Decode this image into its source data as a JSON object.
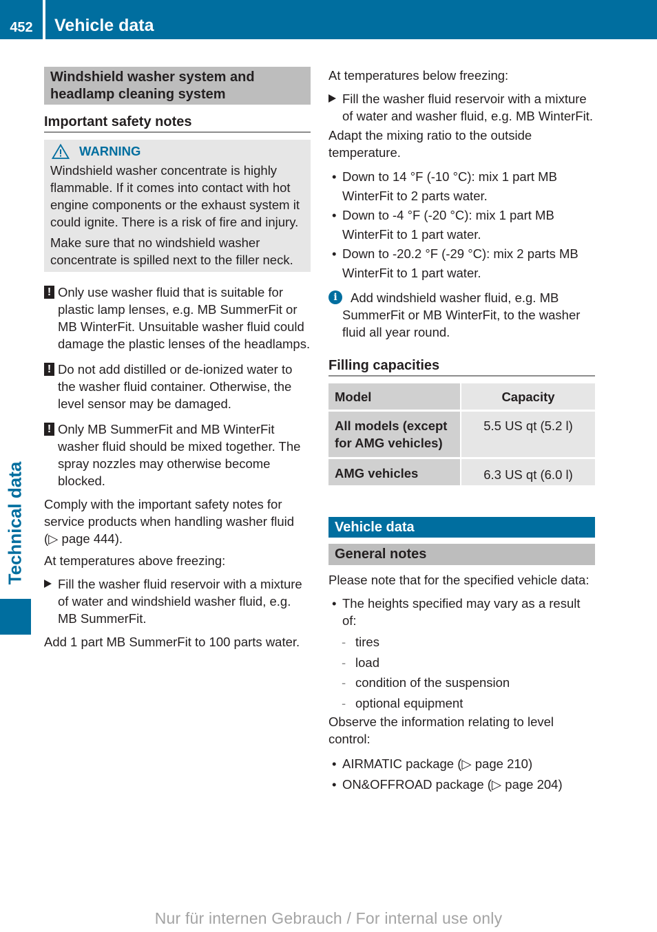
{
  "header": {
    "page_number": "452",
    "title": "Vehicle data"
  },
  "side_tab": {
    "label": "Technical data",
    "color": "#006e9f"
  },
  "left": {
    "section_title": "Windshield washer system and headlamp cleaning system",
    "subsection_title": "Important safety notes",
    "warning": {
      "icon": "warning-triangle-icon",
      "label": "WARNING",
      "paragraphs": [
        "Windshield washer concentrate is highly flammable. If it comes into contact with hot engine components or the exhaust system it could ignite. There is a risk of fire and injury.",
        "Make sure that no windshield washer concentrate is spilled next to the filler neck."
      ]
    },
    "notes": [
      "Only use washer fluid that is suitable for plastic lamp lenses, e.g. MB SummerFit or MB WinterFit. Unsuitable washer fluid could damage the plastic lenses of the headlamps.",
      "Do not add distilled or de-ionized water to the washer fluid container. Otherwise, the level sensor may be damaged.",
      "Only MB SummerFit and MB WinterFit washer fluid should be mixed together. The spray nozzles may otherwise become blocked."
    ],
    "comply_text": "Comply with the important safety notes for service products when handling washer fluid (",
    "comply_ref": "▷ page 444",
    "comply_end": ").",
    "above_freezing": "At temperatures above freezing:",
    "above_step": "Fill the washer fluid reservoir with a mixture of water and windshield washer fluid, e.g. MB SummerFit.",
    "above_ratio": "Add 1 part MB SummerFit to 100 parts water."
  },
  "right": {
    "below_freezing": "At temperatures below freezing:",
    "below_step": "Fill the washer fluid reservoir with a mixture of water and washer fluid, e.g. MB WinterFit.",
    "adapt_text": "Adapt the mixing ratio to the outside temperature.",
    "mix_bullets": [
      "Down to 14 °F (-10 °C): mix 1 part MB WinterFit to 2 parts water.",
      "Down to -4 °F (-20 °C): mix 1 part MB WinterFit to 1 part water.",
      "Down to -20.2 °F (-29 °C): mix 2 parts MB WinterFit to 1 part water."
    ],
    "info_text": "Add windshield washer fluid, e.g. MB SummerFit or MB WinterFit, to the washer fluid all year round.",
    "filling_title": "Filling capacities",
    "table": {
      "headers": [
        "Model",
        "Capacity"
      ],
      "rows": [
        {
          "model": "All models (except for AMG vehicles)",
          "capacity": "5.5 US qt (5.2 l)"
        },
        {
          "model": "AMG vehicles",
          "capacity": "6.3 US qt (6.0 l)"
        }
      ]
    },
    "vehicle_data_title": "Vehicle data",
    "general_notes_title": "General notes",
    "general_intro": "Please note that for the specified vehicle data:",
    "heights_bullet": "The heights specified may vary as a result of:",
    "heights_factors": [
      "tires",
      "load",
      "condition of the suspension",
      "optional equipment"
    ],
    "level_control_text": "Observe the information relating to level control:",
    "level_refs": [
      {
        "label": "AIRMATIC package (",
        "ref": "▷ page 210",
        "end": ")"
      },
      {
        "label": "ON&OFFROAD package (",
        "ref": "▷ page 204",
        "end": ")"
      }
    ]
  },
  "footer": {
    "watermark": "Nur für internen Gebrauch / For internal use only"
  }
}
